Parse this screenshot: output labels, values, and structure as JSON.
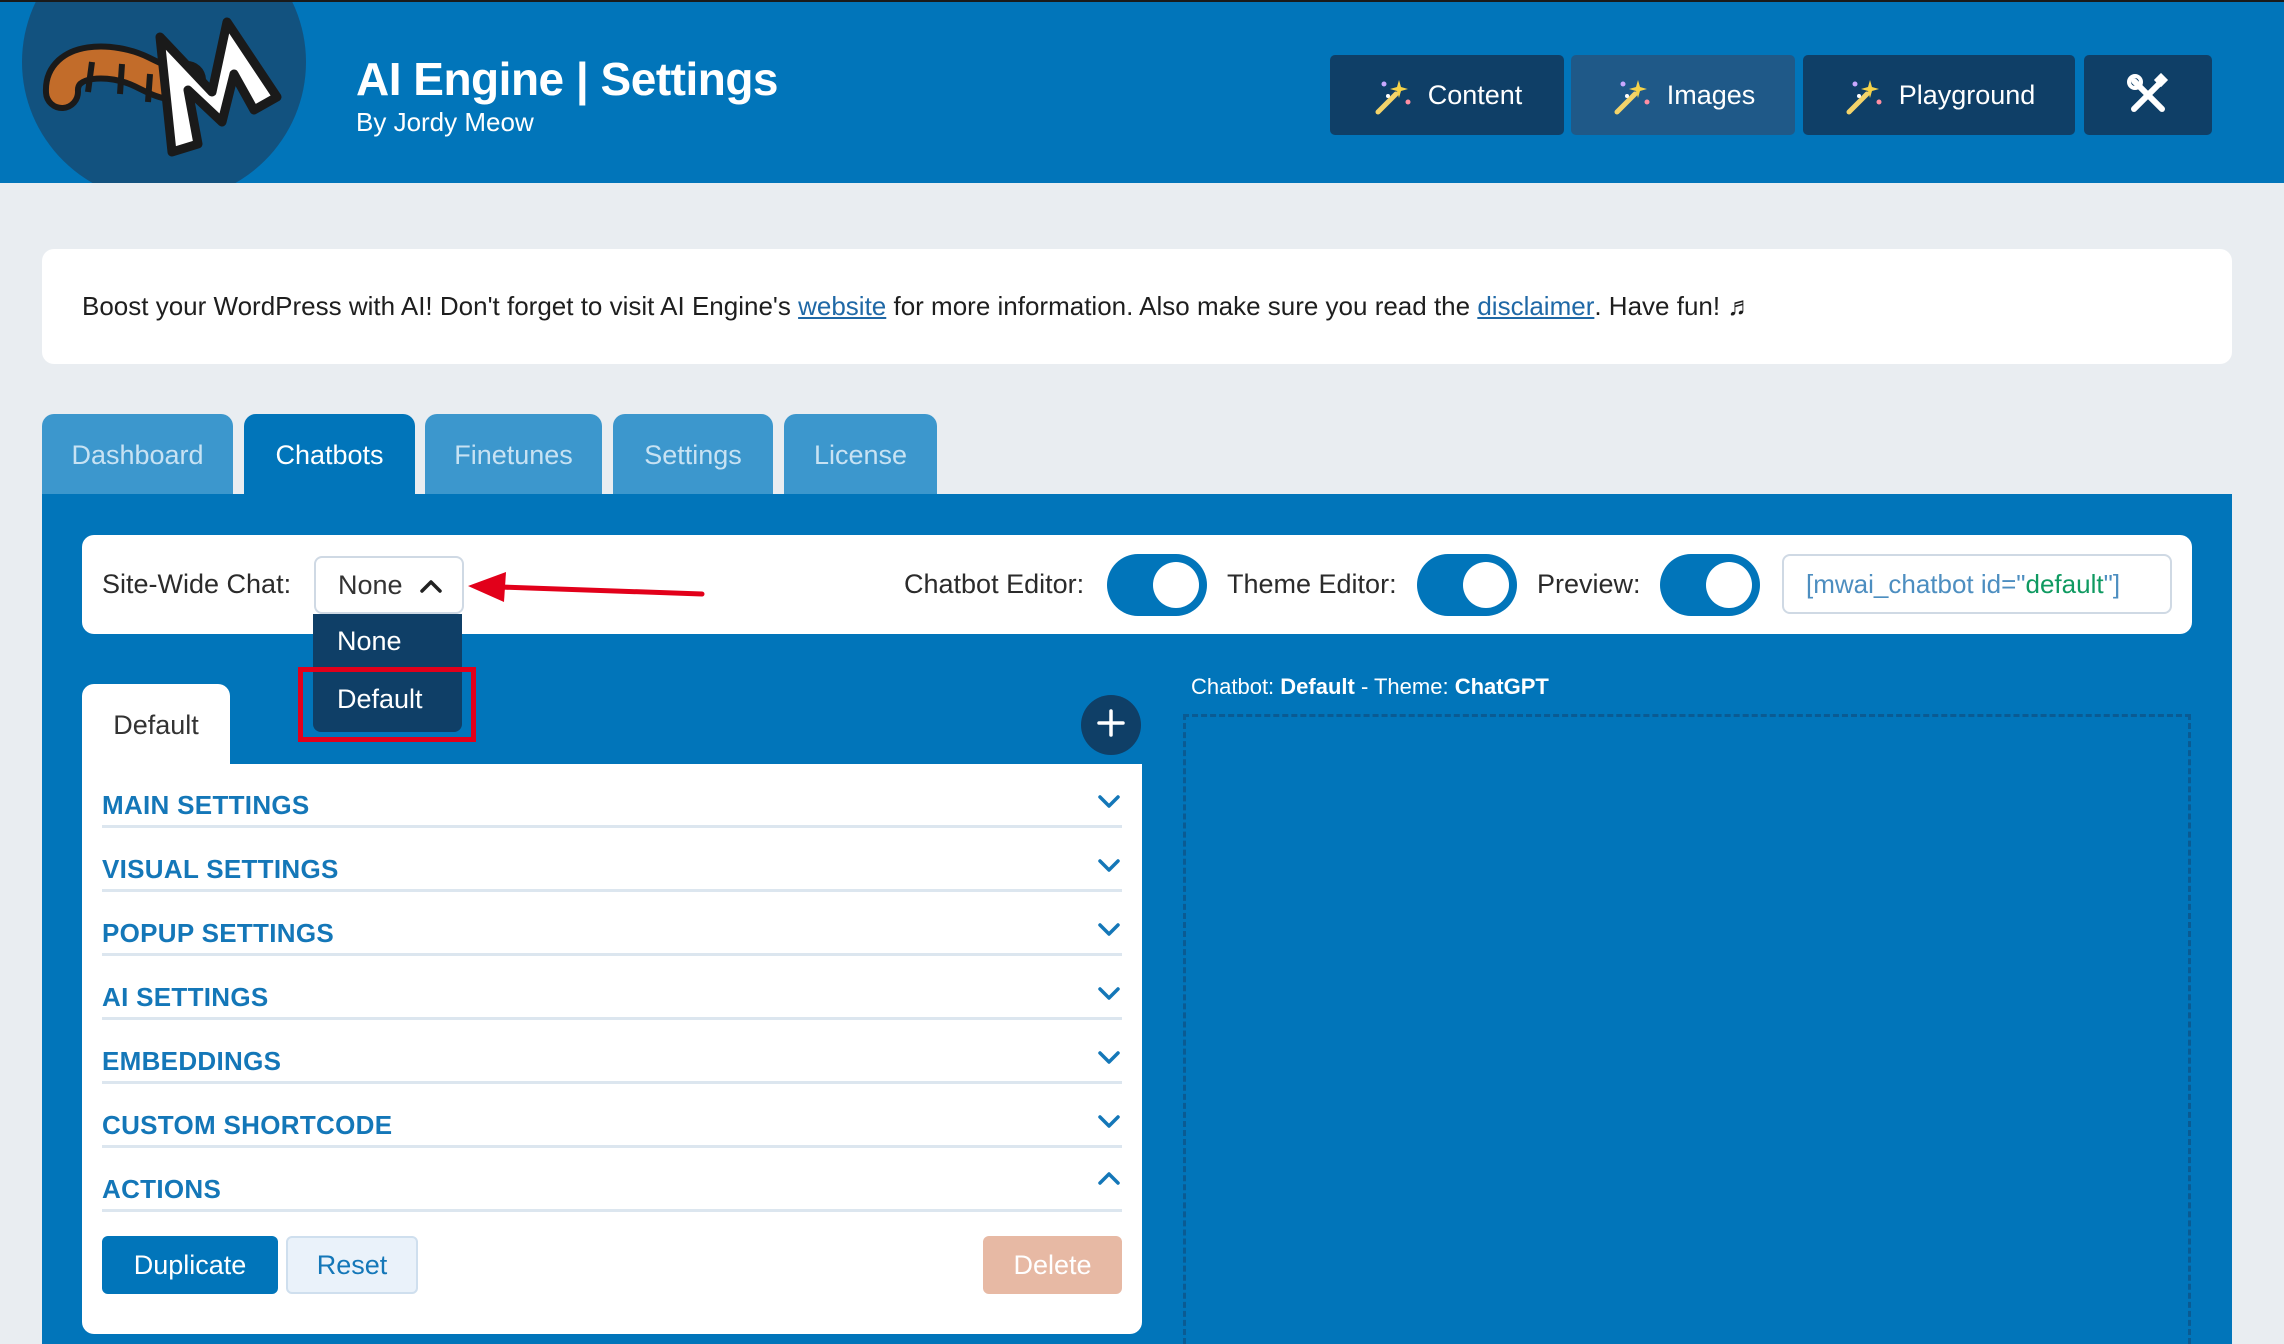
{
  "header": {
    "title": "AI Engine | Settings",
    "subtitle": "By Jordy Meow",
    "buttons": [
      {
        "label": "Content",
        "icon": "magic-wand-icon"
      },
      {
        "label": "Images",
        "icon": "magic-wand-icon"
      },
      {
        "label": "Playground",
        "icon": "magic-wand-icon"
      },
      {
        "label": "",
        "icon": "tools-icon"
      }
    ]
  },
  "notice": {
    "text_before": "Boost your WordPress with AI! Don't forget to visit AI Engine's ",
    "link1": "website",
    "text_middle": " for more information. Also make sure you read the ",
    "link2": "disclaimer",
    "text_after": ". Have fun! ♬"
  },
  "tabs": [
    {
      "label": "Dashboard",
      "active": false
    },
    {
      "label": "Chatbots",
      "active": true
    },
    {
      "label": "Finetunes",
      "active": false
    },
    {
      "label": "Settings",
      "active": false
    },
    {
      "label": "License",
      "active": false
    }
  ],
  "toolbar": {
    "site_wide_label": "Site-Wide Chat:",
    "site_wide_value": "None",
    "chatbot_editor_label": "Chatbot Editor:",
    "theme_editor_label": "Theme Editor:",
    "preview_label": "Preview:",
    "shortcode_prefix": "[mwai_chatbot id=\"",
    "shortcode_id": "default",
    "shortcode_suffix": "\"]"
  },
  "dropdown": {
    "options": [
      "None",
      "Default"
    ],
    "highlighted": "Default"
  },
  "chatbot": {
    "tab_label": "Default",
    "sections": [
      {
        "title": "MAIN SETTINGS",
        "expanded": false
      },
      {
        "title": "VISUAL SETTINGS",
        "expanded": false
      },
      {
        "title": "POPUP SETTINGS",
        "expanded": false
      },
      {
        "title": "AI SETTINGS",
        "expanded": false
      },
      {
        "title": "EMBEDDINGS",
        "expanded": false
      },
      {
        "title": "CUSTOM SHORTCODE",
        "expanded": false
      },
      {
        "title": "ACTIONS",
        "expanded": true
      }
    ],
    "actions": {
      "duplicate": "Duplicate",
      "reset": "Reset",
      "delete": "Delete"
    }
  },
  "preview": {
    "chatbot_label": "Chatbot: ",
    "chatbot_name": "Default",
    "theme_label": " - Theme: ",
    "theme_name": "ChatGPT"
  },
  "colors": {
    "header_bg": "#0175ba",
    "dark_button": "#0f3f67",
    "highlight_red": "#e2001a",
    "link": "#1f68a6",
    "delete_disabled": "#e7b9a4"
  }
}
